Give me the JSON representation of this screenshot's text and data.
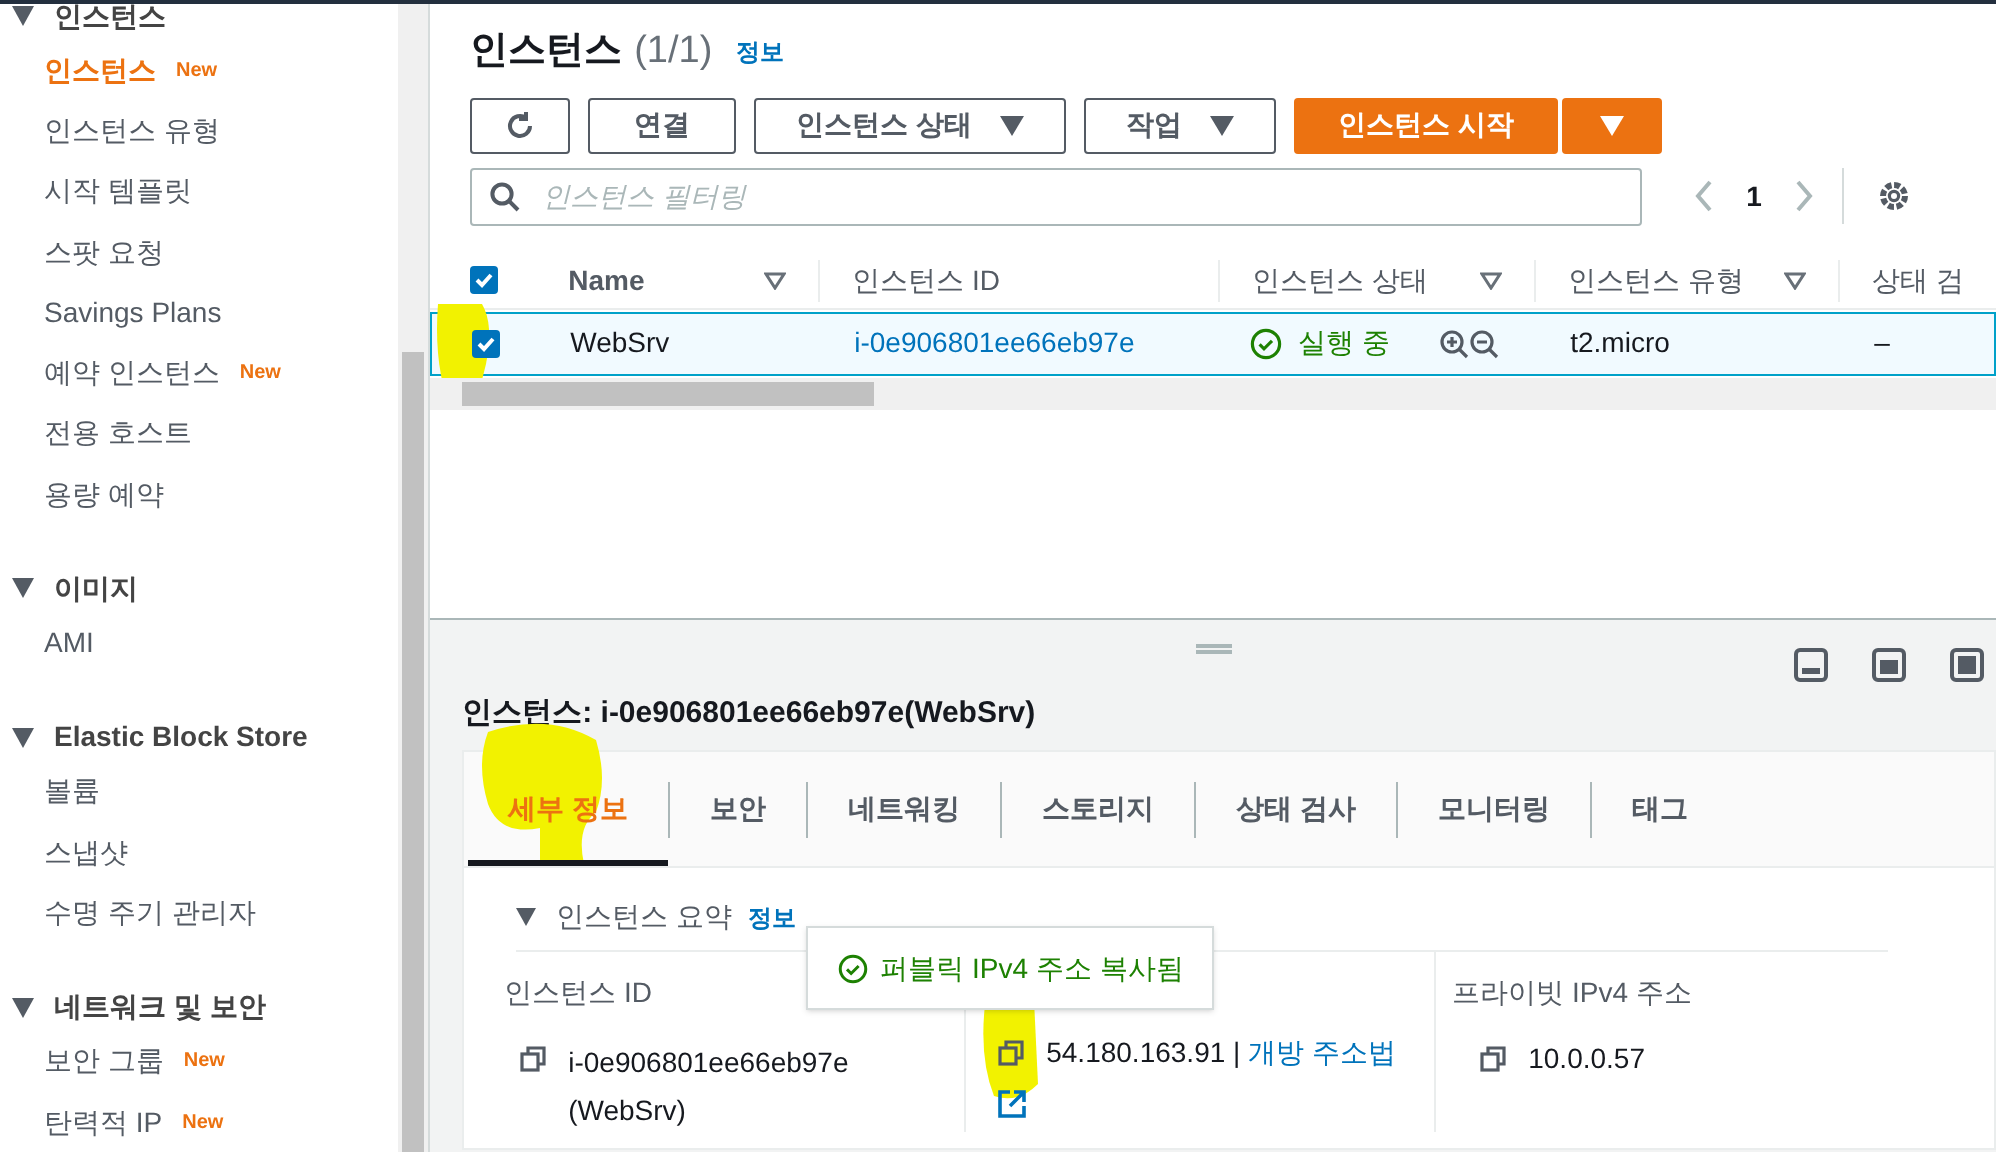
{
  "sidebar": {
    "groups": [
      {
        "title": "인스턴스",
        "expanded": true,
        "items": [
          {
            "label": "인스턴스",
            "badge": "New",
            "selected": true
          },
          {
            "label": "인스턴스 유형",
            "selected": false
          },
          {
            "label": "시작 템플릿",
            "selected": false
          },
          {
            "label": "스팟 요청",
            "selected": false
          },
          {
            "label": "Savings Plans",
            "selected": false
          },
          {
            "label": "예약 인스턴스",
            "badge": "New",
            "selected": false
          },
          {
            "label": "전용 호스트",
            "selected": false
          },
          {
            "label": "용량 예약",
            "selected": false
          }
        ]
      },
      {
        "title": "이미지",
        "expanded": true,
        "items": [
          {
            "label": "AMI",
            "selected": false
          }
        ]
      },
      {
        "title": "Elastic Block Store",
        "expanded": true,
        "items": [
          {
            "label": "볼륨",
            "selected": false
          },
          {
            "label": "스냅샷",
            "selected": false
          },
          {
            "label": "수명 주기 관리자",
            "selected": false
          }
        ]
      },
      {
        "title": "네트워크 및 보안",
        "expanded": true,
        "items": [
          {
            "label": "보안 그룹",
            "badge": "New",
            "selected": false
          },
          {
            "label": "탄력적 IP",
            "badge": "New",
            "selected": false
          }
        ]
      }
    ]
  },
  "header": {
    "title": "인스턴스",
    "count": "(1/1)",
    "info": "정보"
  },
  "toolbar": {
    "buttons": [
      {
        "kind": "icon"
      },
      {
        "kind": "plain",
        "label": "연결"
      },
      {
        "kind": "dropdown",
        "label": "인스턴스 상태"
      },
      {
        "kind": "dropdown",
        "label": "작업"
      },
      {
        "kind": "primary",
        "label": "인스턴스 시작"
      },
      {
        "kind": "primary-caret"
      }
    ]
  },
  "search": {
    "placeholder": "인스턴스 필터링"
  },
  "pagination": {
    "page": "1"
  },
  "table": {
    "all_checked": true,
    "columns": [
      "Name",
      "인스턴스 ID",
      "인스턴스 상태",
      "인스턴스 유형",
      "상태 검"
    ],
    "rows": [
      {
        "checked": true,
        "selected": true,
        "name": "WebSrv",
        "id": "i-0e906801ee66eb97e",
        "state": "실행 중",
        "type": "t2.micro",
        "status_check": "–"
      }
    ]
  },
  "details": {
    "title": "인스턴스: i-0e906801ee66eb97e(WebSrv)",
    "tabs": [
      {
        "label": "세부 정보",
        "selected": true
      },
      {
        "label": "보안",
        "selected": false
      },
      {
        "label": "네트워킹",
        "selected": false
      },
      {
        "label": "스토리지",
        "selected": false
      },
      {
        "label": "상태 검사",
        "selected": false
      },
      {
        "label": "모니터링",
        "selected": false
      },
      {
        "label": "태그",
        "selected": false
      }
    ],
    "section": {
      "title": "인스턴스 요약",
      "info": "정보",
      "expanded": true
    },
    "fields": [
      {
        "label": "인스턴스 ID",
        "value": "i-0e906801ee66eb97e (WebSrv)"
      },
      {
        "value": "54.180.163.91 |",
        "link": "개방 주소법"
      },
      {
        "label": "프라이빗 IPv4 주소",
        "value": "10.0.0.57"
      }
    ],
    "toast": "퍼블릭 IPv4 주소 복사됨"
  }
}
